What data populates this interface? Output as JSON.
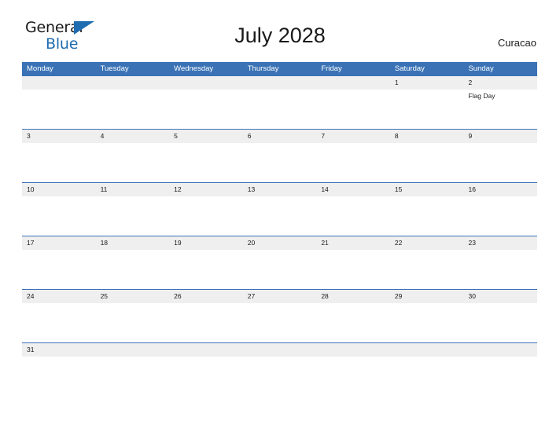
{
  "brand": {
    "line1": "General",
    "line2": "Blue",
    "accent_color": "#1f6cb0",
    "triangle_icon": "triangle-icon"
  },
  "header": {
    "title": "July 2028",
    "locale": "Curacao"
  },
  "theme": {
    "header_blue": "#3a72b5",
    "date_strip_gray": "#efefef",
    "text_dark": "#1a1a1a",
    "white": "#ffffff"
  },
  "calendar": {
    "weekdays": [
      "Monday",
      "Tuesday",
      "Wednesday",
      "Thursday",
      "Friday",
      "Saturday",
      "Sunday"
    ],
    "weeks": [
      {
        "days": [
          {
            "date": "",
            "events": []
          },
          {
            "date": "",
            "events": []
          },
          {
            "date": "",
            "events": []
          },
          {
            "date": "",
            "events": []
          },
          {
            "date": "",
            "events": []
          },
          {
            "date": "1",
            "events": []
          },
          {
            "date": "2",
            "events": [
              "Flag Day"
            ]
          }
        ]
      },
      {
        "days": [
          {
            "date": "3",
            "events": []
          },
          {
            "date": "4",
            "events": []
          },
          {
            "date": "5",
            "events": []
          },
          {
            "date": "6",
            "events": []
          },
          {
            "date": "7",
            "events": []
          },
          {
            "date": "8",
            "events": []
          },
          {
            "date": "9",
            "events": []
          }
        ]
      },
      {
        "days": [
          {
            "date": "10",
            "events": []
          },
          {
            "date": "11",
            "events": []
          },
          {
            "date": "12",
            "events": []
          },
          {
            "date": "13",
            "events": []
          },
          {
            "date": "14",
            "events": []
          },
          {
            "date": "15",
            "events": []
          },
          {
            "date": "16",
            "events": []
          }
        ]
      },
      {
        "days": [
          {
            "date": "17",
            "events": []
          },
          {
            "date": "18",
            "events": []
          },
          {
            "date": "19",
            "events": []
          },
          {
            "date": "20",
            "events": []
          },
          {
            "date": "21",
            "events": []
          },
          {
            "date": "22",
            "events": []
          },
          {
            "date": "23",
            "events": []
          }
        ]
      },
      {
        "days": [
          {
            "date": "24",
            "events": []
          },
          {
            "date": "25",
            "events": []
          },
          {
            "date": "26",
            "events": []
          },
          {
            "date": "27",
            "events": []
          },
          {
            "date": "28",
            "events": []
          },
          {
            "date": "29",
            "events": []
          },
          {
            "date": "30",
            "events": []
          }
        ]
      },
      {
        "days": [
          {
            "date": "31",
            "events": []
          },
          {
            "date": "",
            "events": []
          },
          {
            "date": "",
            "events": []
          },
          {
            "date": "",
            "events": []
          },
          {
            "date": "",
            "events": []
          },
          {
            "date": "",
            "events": []
          },
          {
            "date": "",
            "events": []
          }
        ]
      }
    ]
  }
}
